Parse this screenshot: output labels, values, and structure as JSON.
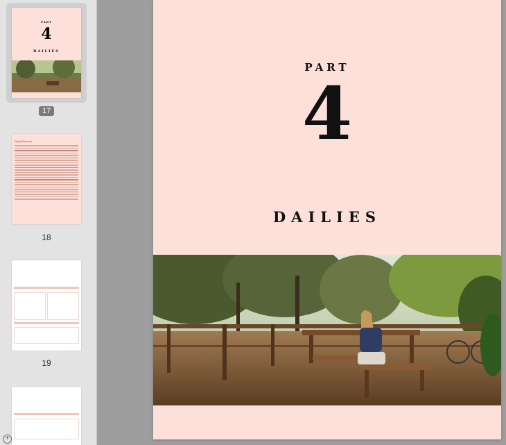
{
  "sidebar": {
    "pages": [
      {
        "number": "17",
        "selected": true
      },
      {
        "number": "18",
        "selected": false
      },
      {
        "number": "19",
        "selected": false
      }
    ],
    "thumb17": {
      "part": "PART",
      "num": "4",
      "title": "DAILIES"
    },
    "thumb18": {
      "heading": "Daily Planner"
    }
  },
  "page": {
    "part_label": "PART",
    "part_number": "4",
    "title": "DAILIES"
  },
  "colors": {
    "page_bg": "#fde0d9",
    "sidebar_bg": "#e3e3e3",
    "canvas_bg": "#9d9d9d"
  },
  "icons": {
    "add": "plus-circle-icon"
  }
}
